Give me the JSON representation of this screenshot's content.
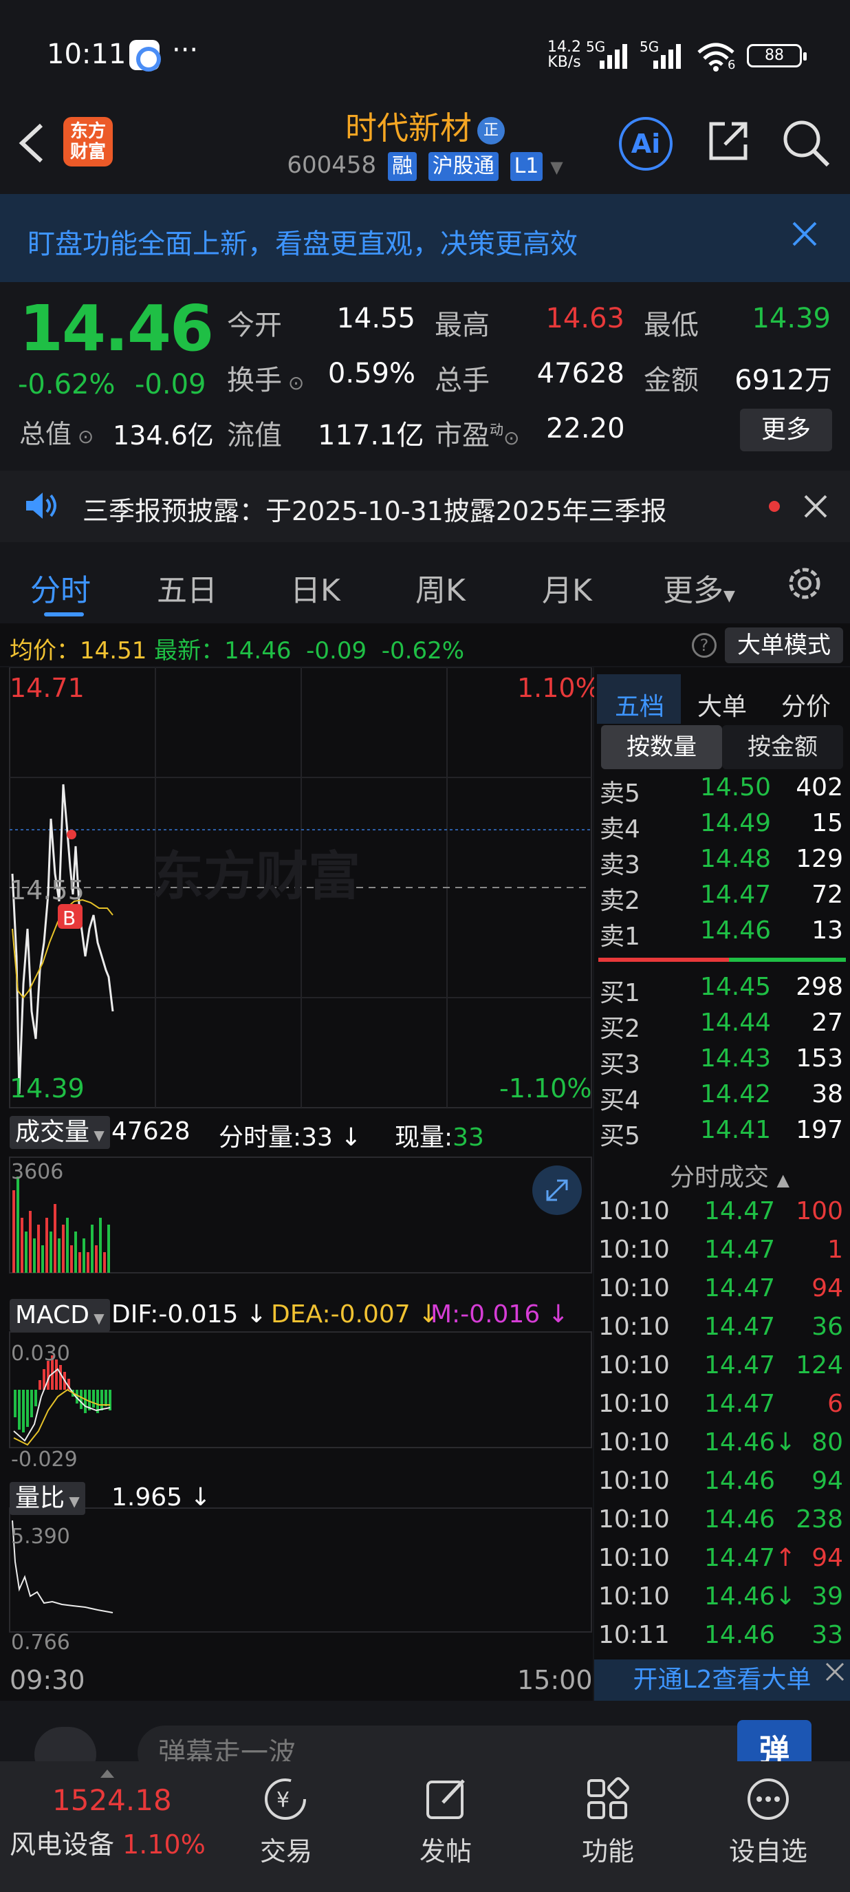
{
  "status_bar": {
    "time": "10:11",
    "net_speed_top": "14.2",
    "net_speed_unit": "KB/s",
    "sig1": "5G",
    "sig2": "5G",
    "wifi_num": "6",
    "battery": "88"
  },
  "header": {
    "stock_name": "时代新材",
    "badge_zheng": "正",
    "code": "600458",
    "tag_rong": "融",
    "tag_hgt": "沪股通",
    "tag_level": "L1",
    "logo_text": "东方财富"
  },
  "banner": {
    "text": "盯盘功能全面上新，看盘更直观，决策更高效"
  },
  "quote": {
    "price": "14.46",
    "change_pct": "-0.62%",
    "change": "-0.09",
    "open_label": "今开",
    "open": "14.55",
    "high_label": "最高",
    "high": "14.63",
    "low_label": "最低",
    "low": "14.39",
    "turnover_label": "换手",
    "turnover": "0.59%",
    "volume_label": "总手",
    "volume": "47628",
    "amount_label": "金额",
    "amount": "6912万",
    "mcap_label": "总值",
    "mcap": "134.6亿",
    "float_label": "流值",
    "float": "117.1亿",
    "pe_label": "市盈",
    "pe_sup": "动",
    "pe": "22.20",
    "more": "更多"
  },
  "notice": {
    "text": "三季报预披露：于2025-10-31披露2025年三季报"
  },
  "tabs": [
    "分时",
    "五日",
    "日K",
    "周K",
    "月K",
    "更多"
  ],
  "infoline": {
    "avg_label": "均价：",
    "avg": "14.51",
    "latest_label": "最新：",
    "latest": "14.46",
    "chg": "-0.09",
    "pct": "-0.62%",
    "big_mode": "大单模式"
  },
  "chart": {
    "top_price": "14.71",
    "top_pct": "1.10%",
    "mid_price": "14.55",
    "bottom_price": "14.39",
    "bottom_pct": "-1.10%",
    "watermark": "东方财富",
    "marker": "B",
    "vol_btn": "成交量",
    "vol_total": "47628",
    "vol_fs_label": "分时量:",
    "vol_fs": "33",
    "vol_now_label": "现量:",
    "vol_now": "33",
    "vol_max": "3606",
    "macd_btn": "MACD",
    "dif": "DIF:-0.015",
    "dea": "DEA:-0.007",
    "m": "M:-0.016",
    "macd_top": "0.030",
    "macd_bottom": "-0.029",
    "lb_btn": "量比",
    "lb_val": "1.965",
    "lb_top": "5.390",
    "lb_bottom": "0.766",
    "time_start": "09:30",
    "time_end": "15:00"
  },
  "right_panel": {
    "tabs": [
      "五档",
      "大单",
      "分价"
    ],
    "seg": [
      "按数量",
      "按金额"
    ],
    "asks": [
      {
        "label": "卖5",
        "price": "14.50",
        "vol": "402"
      },
      {
        "label": "卖4",
        "price": "14.49",
        "vol": "15"
      },
      {
        "label": "卖3",
        "price": "14.48",
        "vol": "129"
      },
      {
        "label": "卖2",
        "price": "14.47",
        "vol": "72"
      },
      {
        "label": "卖1",
        "price": "14.46",
        "vol": "13"
      }
    ],
    "bids": [
      {
        "label": "买1",
        "price": "14.45",
        "vol": "298"
      },
      {
        "label": "买2",
        "price": "14.44",
        "vol": "27"
      },
      {
        "label": "买3",
        "price": "14.43",
        "vol": "153"
      },
      {
        "label": "买4",
        "price": "14.42",
        "vol": "38"
      },
      {
        "label": "买5",
        "price": "14.41",
        "vol": "197"
      }
    ],
    "trades_title": "分时成交",
    "trades": [
      {
        "time": "10:10",
        "price": "14.47",
        "vol": "100",
        "dir": ""
      },
      {
        "time": "10:10",
        "price": "14.47",
        "vol": "1",
        "dir": ""
      },
      {
        "time": "10:10",
        "price": "14.47",
        "vol": "94",
        "dir": ""
      },
      {
        "time": "10:10",
        "price": "14.47",
        "vol": "36",
        "dir": ""
      },
      {
        "time": "10:10",
        "price": "14.47",
        "vol": "124",
        "dir": ""
      },
      {
        "time": "10:10",
        "price": "14.47",
        "vol": "6",
        "dir": ""
      },
      {
        "time": "10:10",
        "price": "14.46↓",
        "vol": "80",
        "dir": ""
      },
      {
        "time": "10:10",
        "price": "14.46",
        "vol": "94",
        "dir": ""
      },
      {
        "time": "10:10",
        "price": "14.46",
        "vol": "238",
        "dir": ""
      },
      {
        "time": "10:10",
        "price": "14.47↑",
        "vol": "94",
        "dir": ""
      },
      {
        "time": "10:10",
        "price": "14.46↓",
        "vol": "39",
        "dir": ""
      },
      {
        "time": "10:11",
        "price": "14.46",
        "vol": "33",
        "dir": ""
      }
    ],
    "l2_text": "开通L2查看大单"
  },
  "comment": {
    "placeholder": "弹幕走一波",
    "danmu_btn": "弹"
  },
  "bottom_nav": {
    "index_value": "1524.18",
    "index_name": "风电设备",
    "index_pct": "1.10%",
    "items": [
      "交易",
      "发帖",
      "功能",
      "设自选"
    ]
  }
}
